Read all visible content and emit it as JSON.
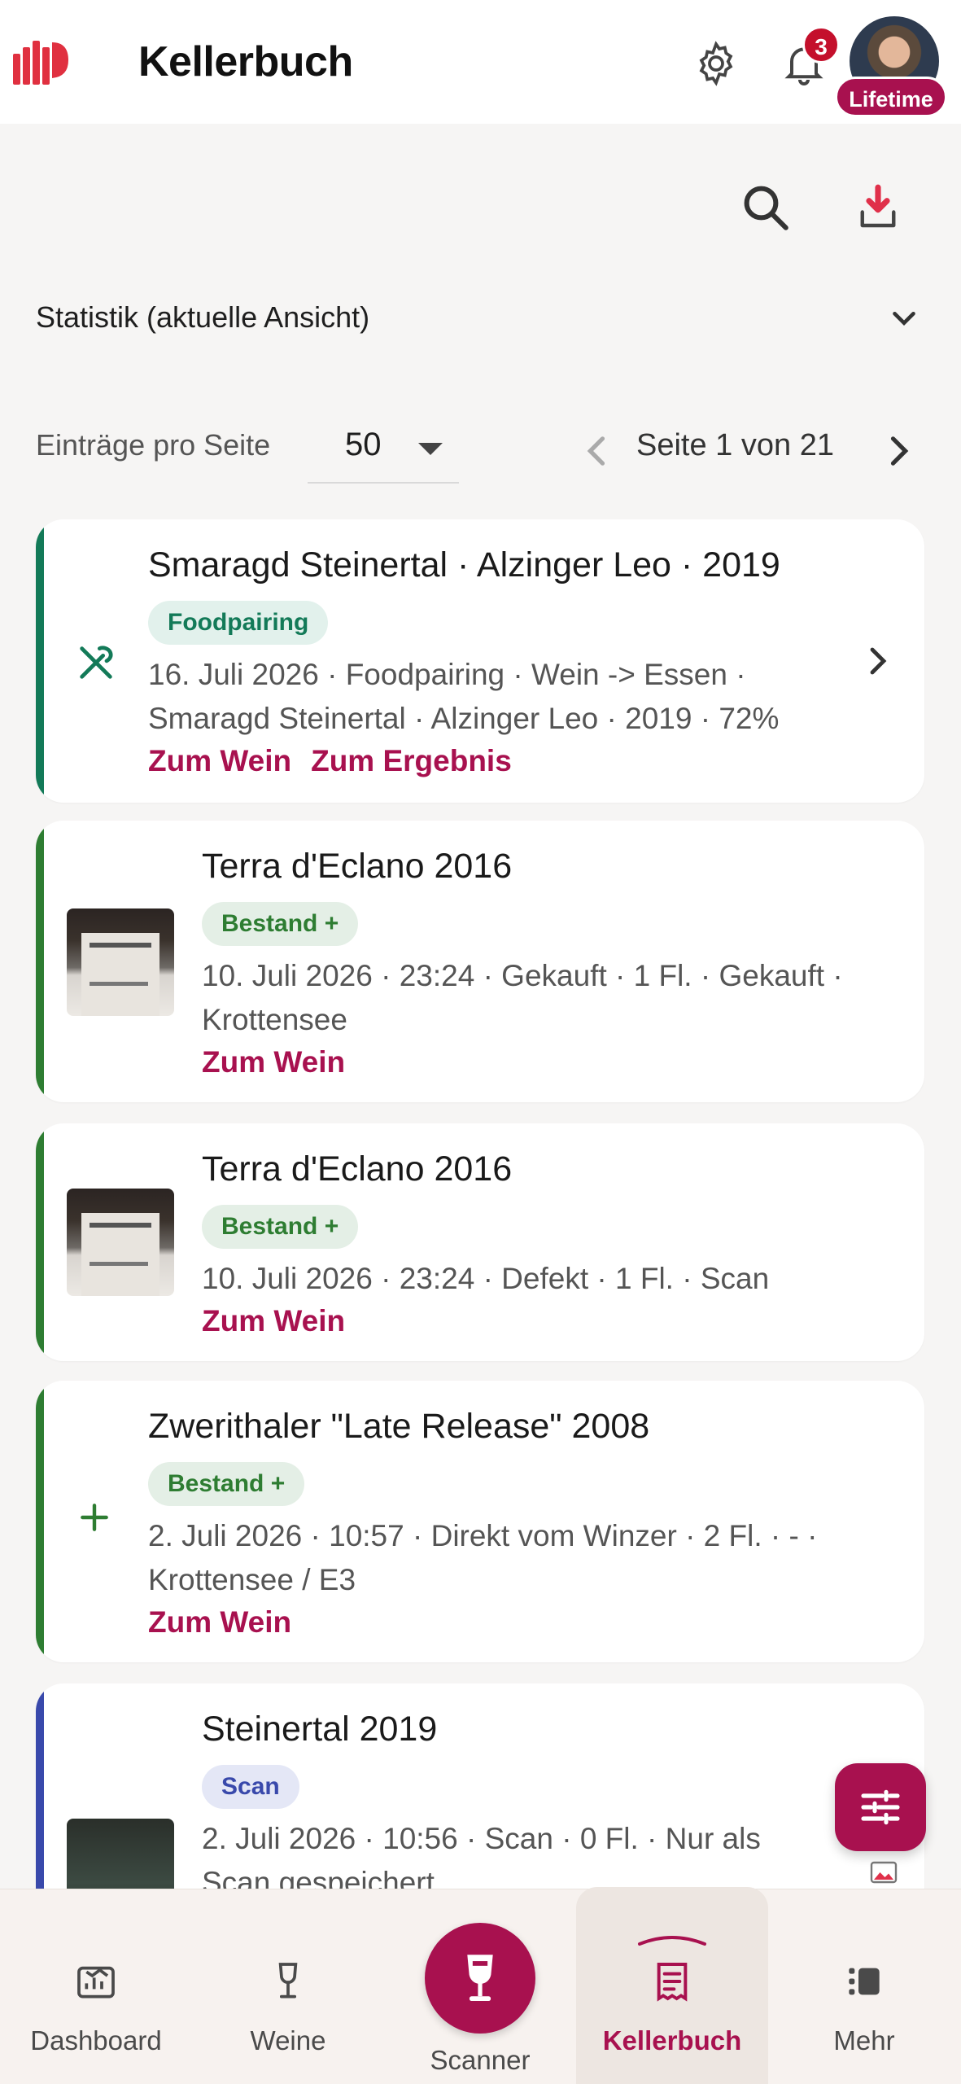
{
  "header": {
    "title": "Kellerbuch",
    "notification_count": "3",
    "plan_badge": "Lifetime",
    "icons": [
      "logo-icon",
      "gear-icon",
      "bell-icon",
      "avatar"
    ]
  },
  "toolbar": {
    "icons": [
      "search-icon",
      "download-icon"
    ]
  },
  "stats": {
    "label": "Statistik (aktuelle Ansicht)"
  },
  "pagination": {
    "per_page_label": "Einträge pro Seite",
    "per_page_value": "50",
    "page_text": "Seite 1 von 21"
  },
  "entries": [
    {
      "title": "Smaragd Steinertal · Alzinger Leo · 2019",
      "chip": "Foodpairing",
      "meta_line1": "16. Juli 2026 · Foodpairing · Wein -> Essen ·",
      "meta_line2": "Smaragd Steinertal · Alzinger Leo · 2019 · 72%",
      "link1": "Zum Wein",
      "link2": "Zum Ergebnis",
      "accent": "#137a58",
      "icon": "fork-knife-icon"
    },
    {
      "title": "Terra d'Eclano 2016",
      "chip": "Bestand +",
      "meta_line1": "10. Juli 2026 · 23:24 · Gekauft · 1 Fl. · Gekauft ·",
      "meta_line2": "Krottensee",
      "link1": "Zum Wein",
      "accent": "#2e7d32"
    },
    {
      "title": "Terra d'Eclano 2016",
      "chip": "Bestand +",
      "meta_line1": "10. Juli 2026 · 23:24 · Defekt · 1 Fl. · Scan",
      "link1": "Zum Wein",
      "accent": "#2e7d32"
    },
    {
      "title": "Zwerithaler \"Late Release\" 2008",
      "chip": "Bestand +",
      "meta_line1": "2. Juli 2026 · 10:57 · Direkt vom Winzer · 2 Fl. · - ·",
      "meta_line2": "Krottensee / E3",
      "link1": "Zum Wein",
      "accent": "#2e7d32",
      "icon": "plus-icon"
    },
    {
      "title": "Steinertal 2019",
      "chip": "Scan",
      "meta_line1": "2. Juli 2026 · 10:56 · Scan · 0 Fl. · Nur als",
      "meta_line2": "Scan gespeichert",
      "accent": "#3949ab"
    }
  ],
  "bottom_nav": {
    "items": [
      {
        "label": "Dashboard",
        "icon": "chart-icon"
      },
      {
        "label": "Weine",
        "icon": "wine-glass-icon"
      },
      {
        "label": "Scanner",
        "icon": "scanner-icon"
      },
      {
        "label": "Kellerbuch",
        "icon": "receipt-icon",
        "active": true
      },
      {
        "label": "Mehr",
        "icon": "list-icon"
      }
    ]
  },
  "colors": {
    "brand": "#a8114f",
    "notification": "#c4102c",
    "green": "#2e7d32",
    "teal": "#137a58",
    "blue": "#3949ab"
  }
}
